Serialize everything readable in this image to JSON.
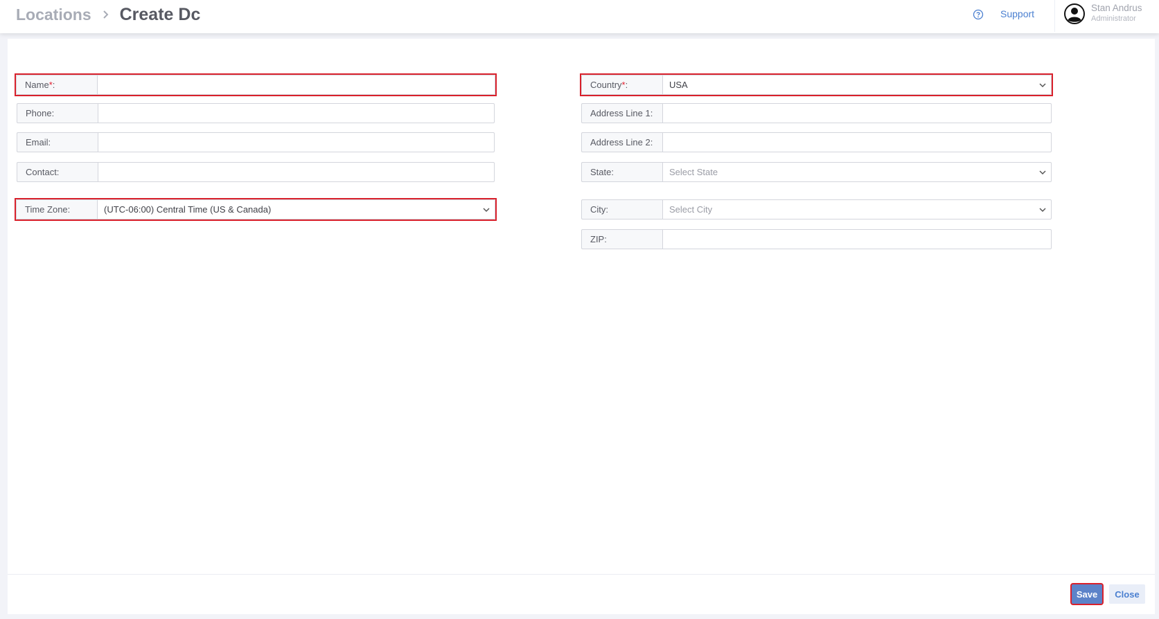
{
  "header": {
    "breadcrumb_root": "Locations",
    "page_title": "Create Dc",
    "support_label": "Support",
    "user_name": "Stan Andrus",
    "user_role": "Administrator"
  },
  "form": {
    "left": {
      "name": {
        "label": "Name",
        "required_mark": "*",
        "suffix": ":",
        "value": ""
      },
      "phone": {
        "label": "Phone:",
        "value": ""
      },
      "email": {
        "label": "Email:",
        "value": ""
      },
      "contact": {
        "label": "Contact:",
        "value": ""
      },
      "timezone": {
        "label": "Time Zone:",
        "value": "(UTC-06:00) Central Time (US & Canada)"
      }
    },
    "right": {
      "country": {
        "label": "Country",
        "required_mark": "*",
        "suffix": ":",
        "value": "USA"
      },
      "address1": {
        "label": "Address Line 1:",
        "value": ""
      },
      "address2": {
        "label": "Address Line 2:",
        "value": ""
      },
      "state": {
        "label": "State:",
        "placeholder": "Select State"
      },
      "city": {
        "label": "City:",
        "placeholder": "Select City"
      },
      "zip": {
        "label": "ZIP:",
        "value": ""
      }
    }
  },
  "actions": {
    "save_label": "Save",
    "close_label": "Close"
  },
  "colors": {
    "accent": "#5c83c9",
    "link": "#4a7fd0",
    "required": "#e01d2c",
    "highlight": "#d9202b"
  }
}
